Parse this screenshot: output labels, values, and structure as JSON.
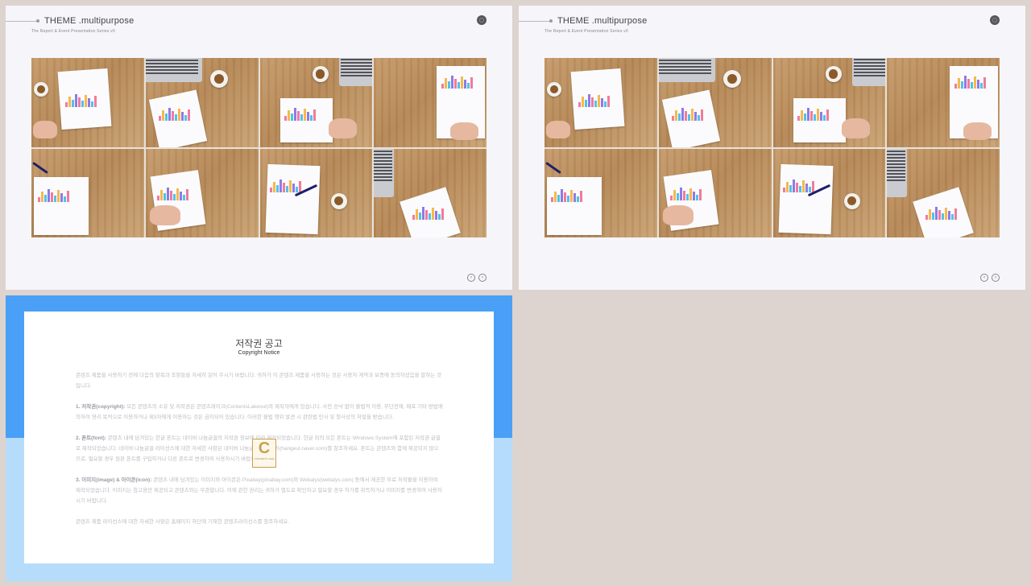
{
  "slides": [
    {
      "title": "THEME .multipurpose",
      "subtitle": "The Report & Event Presentation Series v0",
      "nav": {
        "prev": "‹",
        "next": "›"
      }
    },
    {
      "title": "THEME .multipurpose",
      "subtitle": "The Report & Event Presentation Series v0",
      "nav": {
        "prev": "‹",
        "next": "›"
      }
    }
  ],
  "copyright": {
    "title": "저작권 공고",
    "subtitle": "Copyright Notice",
    "intro": "콘텐츠 제품을 사용하기 전에 다음의 항목과 조항들을 자세히 읽어 주시기 바랍니다. 귀하가 이 콘텐츠 제품을 사용하는 것은 사용자 계약과 보증에 동의하셨음을 말하는 것입니다.",
    "section1_head": "1. 저작권(copyright):",
    "section1": "모든 콘텐츠의 소유 및 저작권은 콘텐츠레이크(ContentsLakeout)와 제작자에게 있습니다. 사전 승낙 없이 불법적 이용, 무단전재, 배포 기타 방법에 의하여 영리 목적으로 이용하거나 제3자에게 이용하는 것은 금지되어 있습니다. 이러한 불법 행위 발견 시 관련법 민사 및 형사상의 처벌을 받습니다.",
    "section2_head": "2. 폰트(font):",
    "section2": "콘텐츠 내에 담겨있는 한글 폰트는 네이버 나눔글꼴의 저작권 정보에 따라 제작되었습니다. 한글 외의 모든 폰트는 Windows System에 포함된 저작권 글꼴로 제작되었습니다. 네이버 나눔글꼴 라이선스에 대한 자세한 사항은 네이버 나눔글꼴 홈페이지(hangeul.naver.com)를 참조하세요. 폰트는 콘텐츠와 함께 제공되지 않으므로, 필요할 경우 원본 폰트를 구입하거나 다른 폰트로 변경하여 사용하시기 바랍니다.",
    "section3_head": "3. 이미지(image) & 아이콘(icon):",
    "section3": "콘텐츠 내에 담겨있는 이미지와 아이콘은 Pixabay(pixabay.com)와 Webalys(webalys.com) 등에서 제공한 무료 저작물을 이용하여 제작되었습니다. 이미지는 참고용만 제공되고 콘텐츠와는 무관합니다. 이에 관한 권리는 귀하가 별도로 확인하고 필요할 경우 허가를 취득하거나 이미지를 변경하여 사용하시기 바랍니다.",
    "footer": "콘텐츠 제품 라이선스에 대한 자세한 사항은 홈페이지 하단에 기재한 콘텐츠라이선스를 참조하세요.",
    "logo_letter": "C",
    "logo_text": "CONTENTS LAKE"
  }
}
